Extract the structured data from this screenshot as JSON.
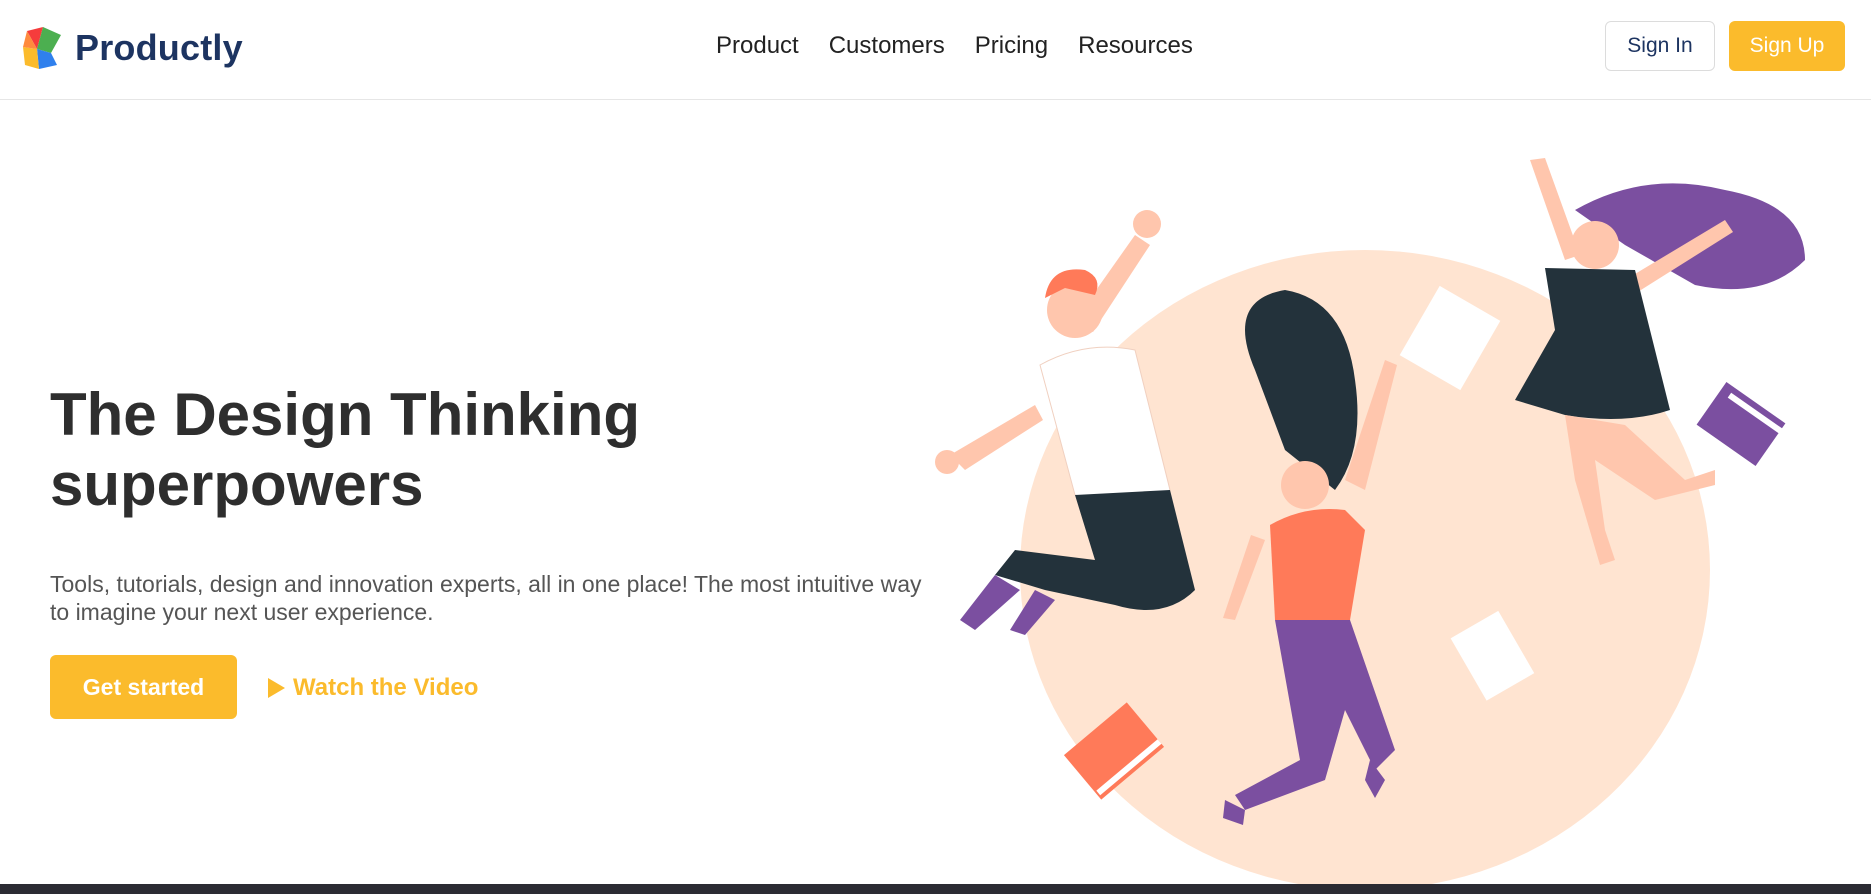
{
  "brand": {
    "name": "Productly",
    "logo_icon": "productly-logo-icon"
  },
  "nav": {
    "links": [
      "Product",
      "Customers",
      "Pricing",
      "Resources"
    ]
  },
  "auth": {
    "sign_in": "Sign In",
    "sign_up": "Sign Up"
  },
  "hero": {
    "title_line1": "The Design Thinking",
    "title_line2": "superpowers",
    "subtitle": "Tools, tutorials, design and innovation experts, all in one place! The most intuitive way to imagine your next user experience.",
    "cta_primary": "Get started",
    "cta_secondary": "Watch the Video",
    "cta_secondary_icon": "play-icon"
  },
  "colors": {
    "accent": "#fbbb2c",
    "brand_text": "#1d3461",
    "heading": "#2e2e2e",
    "body_text": "#555555",
    "illustration_circle": "#ffe4d1",
    "purple": "#7b4fa0",
    "coral": "#ff7a59",
    "dark": "#23323b"
  }
}
